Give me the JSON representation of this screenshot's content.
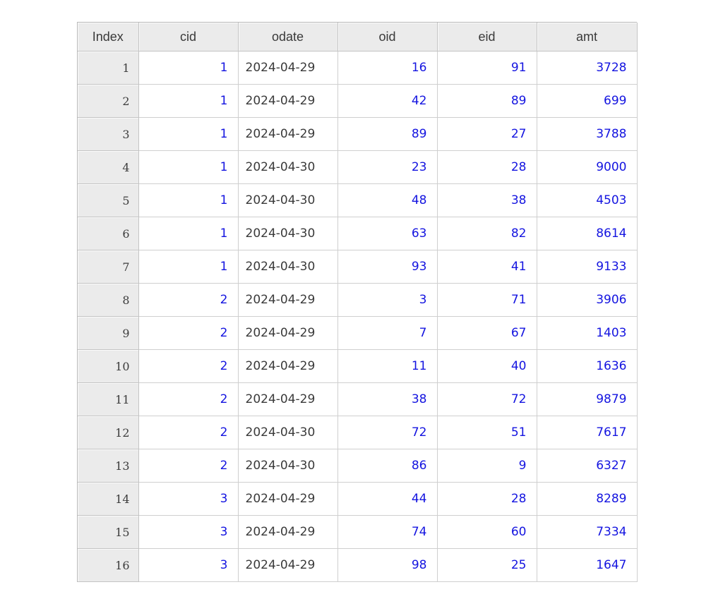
{
  "table": {
    "columns": [
      "Index",
      "cid",
      "odate",
      "oid",
      "eid",
      "amt"
    ],
    "rows": [
      {
        "index": "1",
        "cid": "1",
        "odate": "2024-04-29",
        "oid": "16",
        "eid": "91",
        "amt": "3728"
      },
      {
        "index": "2",
        "cid": "1",
        "odate": "2024-04-29",
        "oid": "42",
        "eid": "89",
        "amt": "699"
      },
      {
        "index": "3",
        "cid": "1",
        "odate": "2024-04-29",
        "oid": "89",
        "eid": "27",
        "amt": "3788"
      },
      {
        "index": "4",
        "cid": "1",
        "odate": "2024-04-30",
        "oid": "23",
        "eid": "28",
        "amt": "9000"
      },
      {
        "index": "5",
        "cid": "1",
        "odate": "2024-04-30",
        "oid": "48",
        "eid": "38",
        "amt": "4503"
      },
      {
        "index": "6",
        "cid": "1",
        "odate": "2024-04-30",
        "oid": "63",
        "eid": "82",
        "amt": "8614"
      },
      {
        "index": "7",
        "cid": "1",
        "odate": "2024-04-30",
        "oid": "93",
        "eid": "41",
        "amt": "9133"
      },
      {
        "index": "8",
        "cid": "2",
        "odate": "2024-04-29",
        "oid": "3",
        "eid": "71",
        "amt": "3906"
      },
      {
        "index": "9",
        "cid": "2",
        "odate": "2024-04-29",
        "oid": "7",
        "eid": "67",
        "amt": "1403"
      },
      {
        "index": "10",
        "cid": "2",
        "odate": "2024-04-29",
        "oid": "11",
        "eid": "40",
        "amt": "1636"
      },
      {
        "index": "11",
        "cid": "2",
        "odate": "2024-04-29",
        "oid": "38",
        "eid": "72",
        "amt": "9879"
      },
      {
        "index": "12",
        "cid": "2",
        "odate": "2024-04-30",
        "oid": "72",
        "eid": "51",
        "amt": "7617"
      },
      {
        "index": "13",
        "cid": "2",
        "odate": "2024-04-30",
        "oid": "86",
        "eid": "9",
        "amt": "6327"
      },
      {
        "index": "14",
        "cid": "3",
        "odate": "2024-04-29",
        "oid": "44",
        "eid": "28",
        "amt": "8289"
      },
      {
        "index": "15",
        "cid": "3",
        "odate": "2024-04-29",
        "oid": "74",
        "eid": "60",
        "amt": "7334"
      },
      {
        "index": "16",
        "cid": "3",
        "odate": "2024-04-29",
        "oid": "98",
        "eid": "25",
        "amt": "1647"
      }
    ]
  },
  "colors": {
    "header_bg": "#ebebeb",
    "number_text": "#1414e0",
    "date_text": "#3a3a3a",
    "grid_line": "#cfcfcf"
  }
}
